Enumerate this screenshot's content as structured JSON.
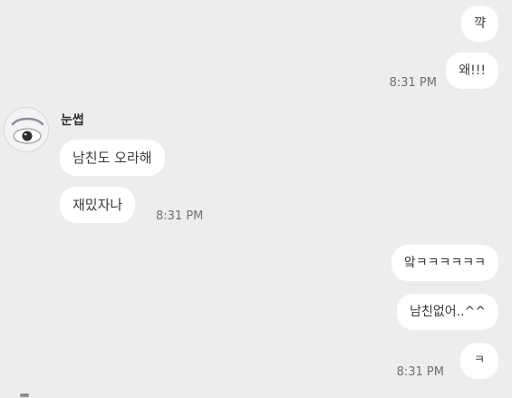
{
  "messages": {
    "outgoing_top_1": "꺅",
    "outgoing_top_2": "왜!!!",
    "outgoing_top_time": "8:31 PM",
    "incoming_sender_name": "눈썹",
    "incoming_1": "남친도 오라해",
    "incoming_2": "재밌자나",
    "incoming_time": "8:31 PM",
    "outgoing_bottom_1": "앜ㅋㅋㅋㅋㅋㅋ",
    "outgoing_bottom_2": "남친없어..^^",
    "outgoing_bottom_3": "ㅋ",
    "outgoing_bottom_time": "8:31 PM"
  },
  "avatar": {
    "icon": "eye-avatar-icon"
  },
  "colors": {
    "background": "#ededed",
    "bubble": "#ffffff",
    "text": "#3a3a3a",
    "time": "#6f6f6f"
  }
}
